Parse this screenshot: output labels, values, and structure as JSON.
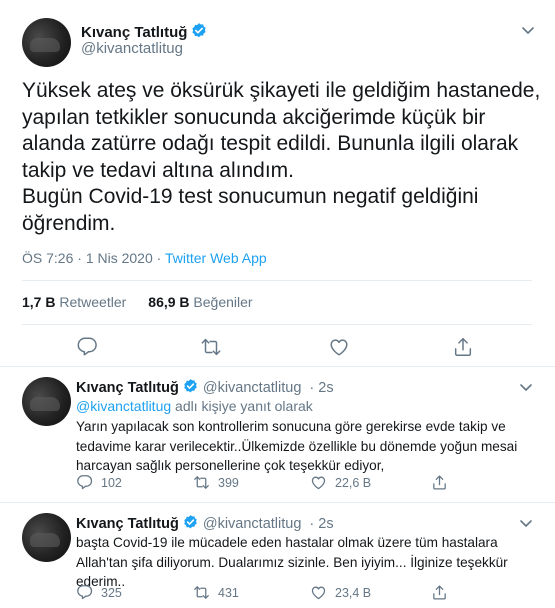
{
  "main_tweet": {
    "author_name": "Kıvanç Tatlıtuğ",
    "author_handle": "@kivanctatlitug",
    "text": "Yüksek ateş ve öksürük şikayeti ile geldiğim hastanede,\nyapılan tetkikler sonucunda akciğerimde küçük bir\nalanda zatürre odağı tespit edildi. Bununla ilgili olarak\ntakip ve tedavi altına alındım.\nBugün Covid-19 test sonucumun negatif geldiğini\nöğrendim.",
    "time": "ÖS 7:26",
    "date": "1 Nis 2020",
    "source": "Twitter Web App",
    "retweets_count": "1,7 B",
    "retweets_label": "Retweetler",
    "likes_count": "86,9 B",
    "likes_label": "Beğeniler"
  },
  "replies": [
    {
      "author_name": "Kıvanç Tatlıtuğ",
      "author_handle": "@kivanctatlitug",
      "age": "2s",
      "reply_to_mention": "@kivanctatlitug",
      "reply_to_suffix": "adlı kişiye yanıt olarak",
      "text_lines": [
        "Yarın yapılacak son kontrollerim sonucuna göre gerekirse evde takip ve",
        "tedavime karar verilecektir..Ülkemizde özellikle bu dönemde yoğun mesai",
        "harcayan sağlık personellerine çok teşekkür ediyor,"
      ],
      "reply_count": "102",
      "retweet_count": "399",
      "like_count": "22,6 B"
    },
    {
      "author_name": "Kıvanç Tatlıtuğ",
      "author_handle": "@kivanctatlitug",
      "age": "2s",
      "text_lines": [
        "başta Covid-19 ile mücadele eden hastalar olmak üzere tüm hastalara",
        "Allah'tan şifa diliyorum. Dualarımız sizinle. Ben iyiyim... İlginize teşekkür",
        "ederim.."
      ],
      "reply_count": "325",
      "retweet_count": "431",
      "like_count": "23,4 B"
    }
  ],
  "icons": {
    "verified": "verified-badge-icon",
    "menu": "chevron-down-icon",
    "reply": "reply-icon",
    "retweet": "retweet-icon",
    "like": "heart-icon",
    "share": "share-icon"
  },
  "colors": {
    "accent": "#1da1f2",
    "secondary_text": "#657786",
    "primary_text": "#14171a",
    "divider": "#e6ecf0"
  }
}
